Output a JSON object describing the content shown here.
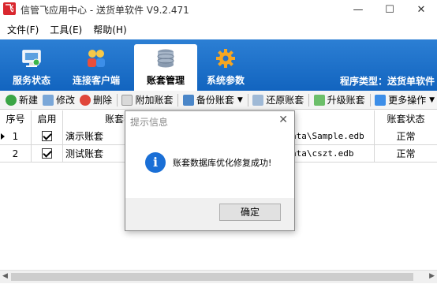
{
  "window": {
    "title": "信管飞应用中心 - 送货单软件 V9.2.471",
    "app_icon_letter": "飞",
    "minimize_glyph": "—",
    "maximize_glyph": "☐",
    "close_glyph": "✕"
  },
  "menu": [
    "文件(F)",
    "工具(E)",
    "帮助(H)"
  ],
  "ribbon": {
    "tabs": [
      {
        "label": "服务状态",
        "icon": "monitor-icon"
      },
      {
        "label": "连接客户端",
        "icon": "users-icon"
      },
      {
        "label": "账套管理",
        "icon": "database-icon",
        "active": true
      },
      {
        "label": "系统参数",
        "icon": "gear-icon"
      }
    ],
    "program_type": "程序类型：送货单软件",
    "color_top": "#2c7fd4",
    "color_bottom": "#1264bf"
  },
  "toolbar": {
    "new": "新建",
    "edit": "修改",
    "delete": "删除",
    "attach": "附加账套",
    "backup": "备份账套",
    "restore": "还原账套",
    "upgrade": "升级账套",
    "more": "更多操作"
  },
  "table": {
    "headers": {
      "index": "序号",
      "enabled": "启用",
      "name": "账套名称",
      "path": "",
      "status": "账套状态"
    },
    "rows": [
      {
        "index": "1",
        "enabled": true,
        "name": "演示账套",
        "path": "ata\\Sample.edb",
        "status": "正常"
      },
      {
        "index": "2",
        "enabled": true,
        "name": "测试账套",
        "path": "ata\\cszt.edb",
        "status": "正常"
      }
    ]
  },
  "dialog": {
    "title": "提示信息",
    "message": "账套数据库优化修复成功!",
    "ok_label": "确定",
    "icon": "info-icon",
    "icon_glyph": "i"
  }
}
